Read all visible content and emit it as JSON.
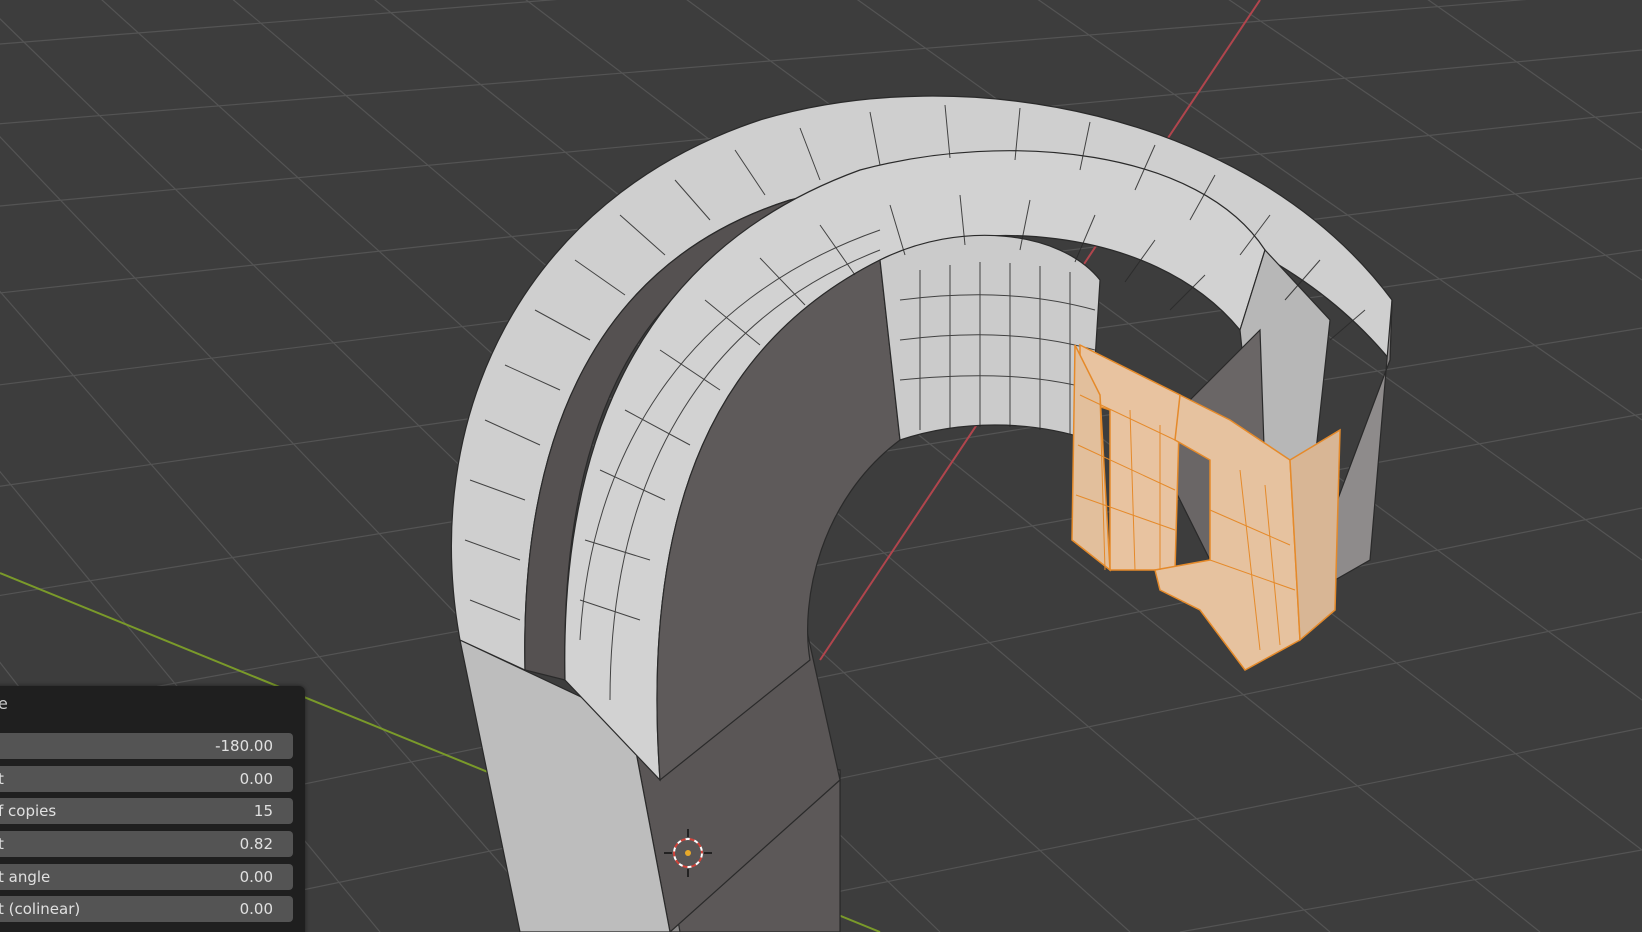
{
  "app": {
    "view": "3D Viewport",
    "mode": "Edit Mode"
  },
  "colors": {
    "viewport_bg": "#3d3d3d",
    "grid_line": "#525252",
    "x_axis": "#b0454d",
    "y_axis": "#7a9a2a",
    "mesh_face": "#c4c4c4",
    "mesh_face_dark": "#5a5656",
    "selected_face": "#e8c3a0",
    "selected_edge": "#e58a2a",
    "panel_bg": "#1f1f1f",
    "field_bg": "#545454"
  },
  "operator_panel": {
    "title": "e",
    "fields": [
      {
        "label": "",
        "value": "-180.00"
      },
      {
        "label": "t",
        "value": "0.00"
      },
      {
        "label": "f copies",
        "value": "15"
      },
      {
        "label": "t",
        "value": "0.82"
      },
      {
        "label": "t angle",
        "value": "0.00"
      },
      {
        "label": "t (colinear)",
        "value": "0.00"
      }
    ]
  },
  "icons": {
    "cursor": "3d-cursor-icon"
  }
}
